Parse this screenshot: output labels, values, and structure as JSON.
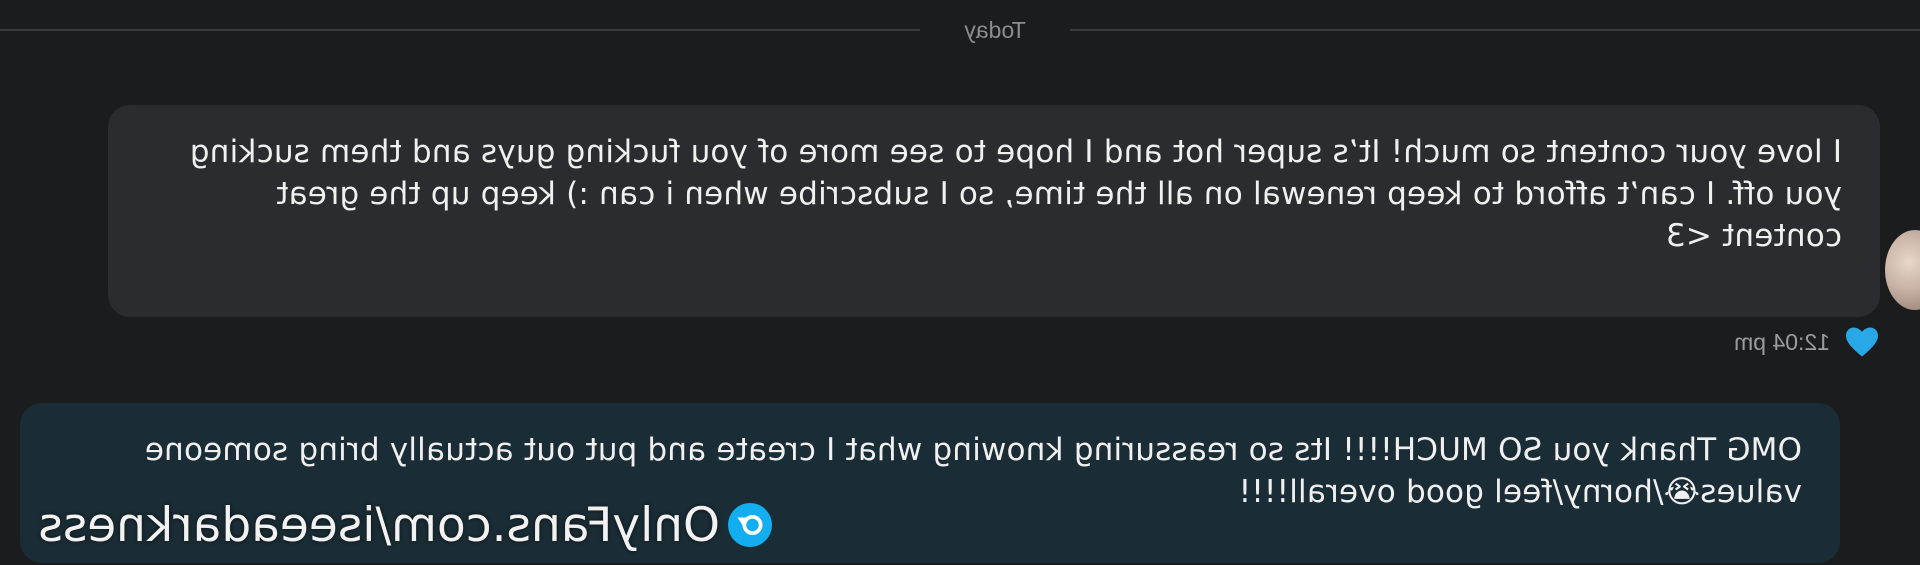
{
  "divider": {
    "label": "Today"
  },
  "incoming_message": {
    "text": "I love your content so much! It’s super hot and I hope to see more of you fucking guys and them sucking you off. I can’t afford to keep renewal on all the time, so I subscribe when i can :) keep up the great content <3",
    "time": "12:04 pm",
    "liked": true
  },
  "outgoing_message": {
    "text": "OMG Thank you SO MUCH!!!! Its so reassuring knowing what I create and put out actually bring someone values😭/horny/feel good overall!!!!"
  },
  "watermark": {
    "text": "OnlyFans.com/iseeadarkness"
  },
  "colors": {
    "background": "#1b1c1e",
    "incoming_bubble": "#2b2c2f",
    "outgoing_bubble": "#1a2c35",
    "like_heart": "#29a8e8",
    "watermark_icon": "#12aef0"
  },
  "icons": {
    "like": "heart-icon",
    "watermark": "onlyfans-lock-icon"
  }
}
